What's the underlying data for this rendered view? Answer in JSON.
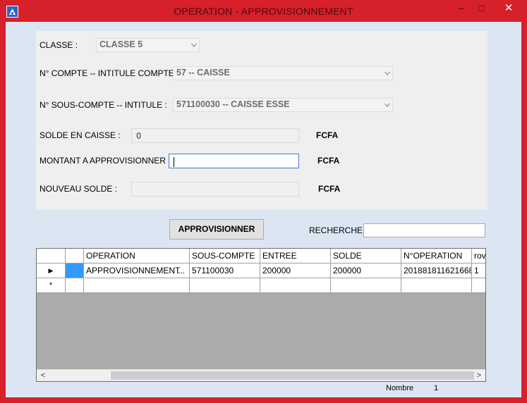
{
  "window": {
    "title": "OPERATION - APPROVISIONNEMENT",
    "minimize": "–",
    "maximize": "□",
    "close": "✕"
  },
  "form": {
    "classe_label": "CLASSE :",
    "classe_value": "CLASSE 5",
    "compte_label": "N° COMPTE -- INTITULE COMPTE:",
    "compte_value": "57  --  CAISSE",
    "souscompte_label": "N° SOUS-COMPTE -- INTITULE :",
    "souscompte_value": "571100030  --  CAISSE ESSE",
    "solde_label": "SOLDE EN CAISSE :",
    "solde_value": "0",
    "montant_label": "MONTANT A APPROVISIONNER :",
    "montant_value": "",
    "nouveau_label": "NOUVEAU SOLDE :",
    "nouveau_value": "",
    "currency": "FCFA"
  },
  "actions": {
    "approvisionner_label": "APPROVISIONNER",
    "recherche_label": "RECHERCHE",
    "recherche_value": ""
  },
  "grid": {
    "columns": [
      "OPERATION",
      "SOUS-COMPTE",
      "ENTREE",
      "SOLDE",
      "N°OPERATION",
      "rov"
    ],
    "rows": [
      {
        "operation": "APPROVISIONNEMENT",
        "operation_more": "...",
        "sous_compte": "571100030",
        "entree": "200000",
        "solde": "200000",
        "num_operation": "201881811621668",
        "rov": "1"
      }
    ],
    "current_row_marker": "▶",
    "new_row_marker": "*",
    "scroll_left": "<",
    "scroll_right": ">"
  },
  "status": {
    "count_label": "Nombre",
    "count_value": "1"
  },
  "colors": {
    "frame": "#d6202a",
    "client": "#dce6f3",
    "selection": "#3399ff"
  }
}
